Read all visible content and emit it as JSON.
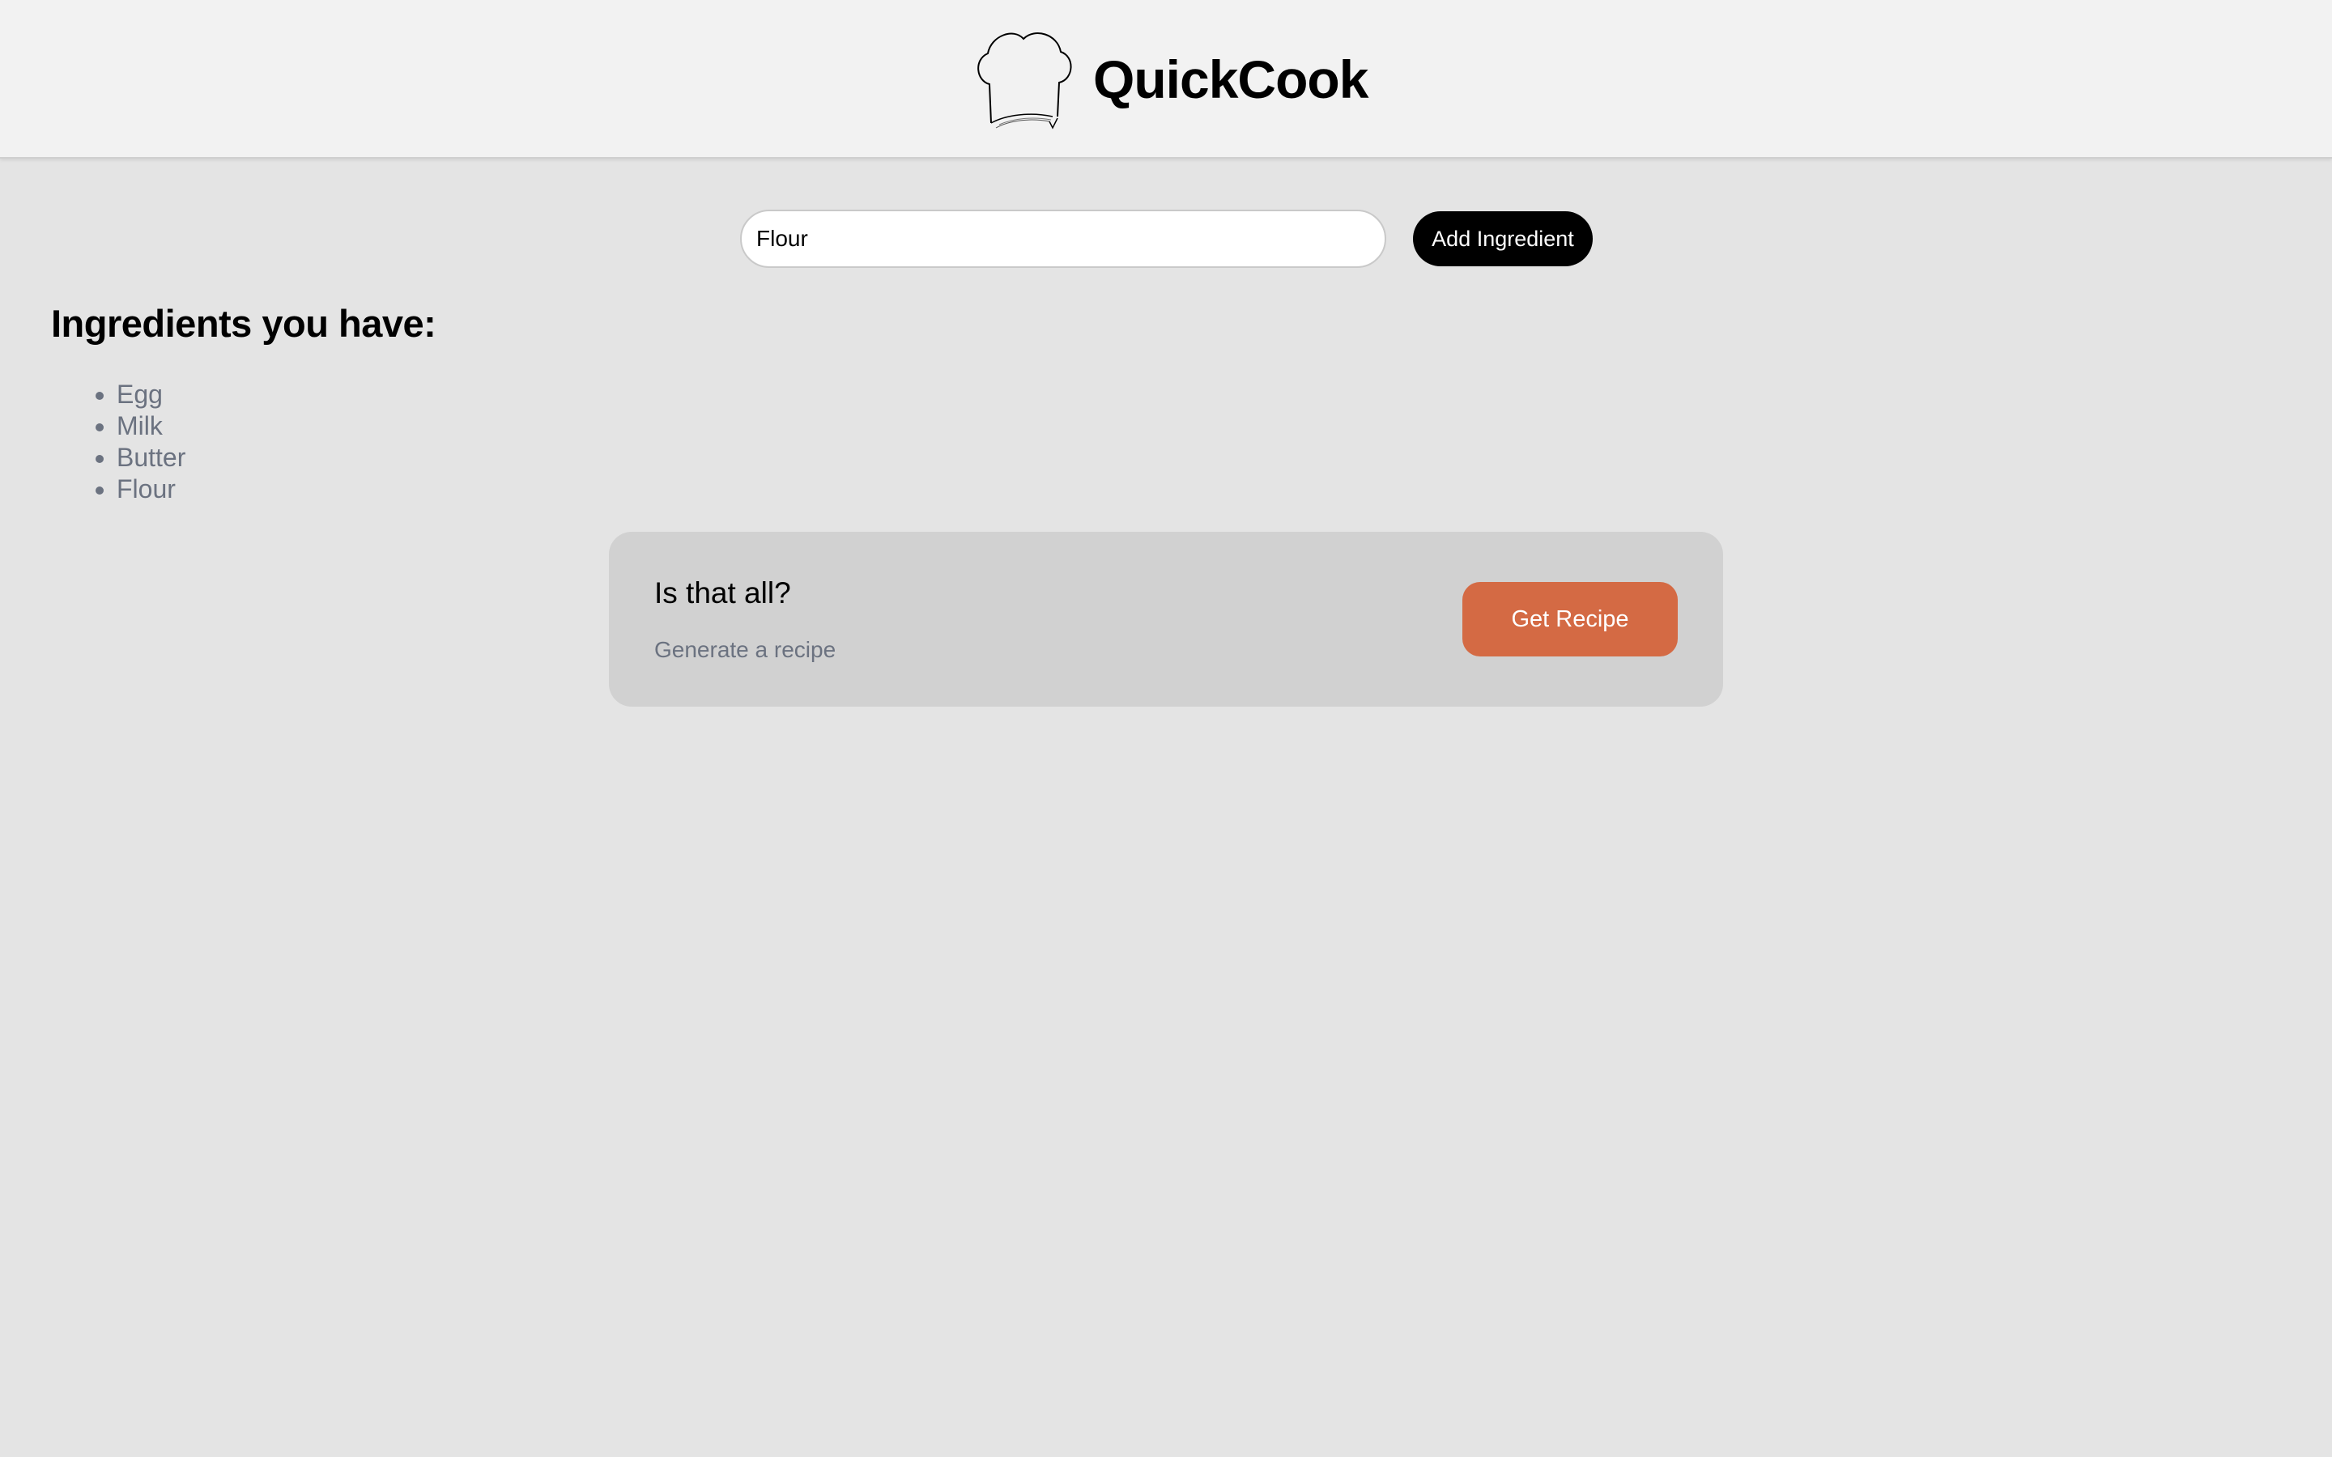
{
  "header": {
    "app_title": "QuickCook",
    "logo_icon": "chef-hat-icon"
  },
  "ingredient_form": {
    "input_value": "Flour",
    "add_button_label": "Add Ingredient"
  },
  "ingredients": {
    "heading": "Ingredients you have:",
    "items": [
      "Egg",
      "Milk",
      "Butter",
      "Flour"
    ]
  },
  "prompt_card": {
    "title": "Is that all?",
    "subtitle": "Generate a recipe",
    "button_label": "Get Recipe"
  },
  "colors": {
    "page_background": "#e4e4e4",
    "header_background": "#f2f2f2",
    "card_background": "#d1d1d1",
    "accent": "#d46a44",
    "muted_text": "#6b7280"
  }
}
